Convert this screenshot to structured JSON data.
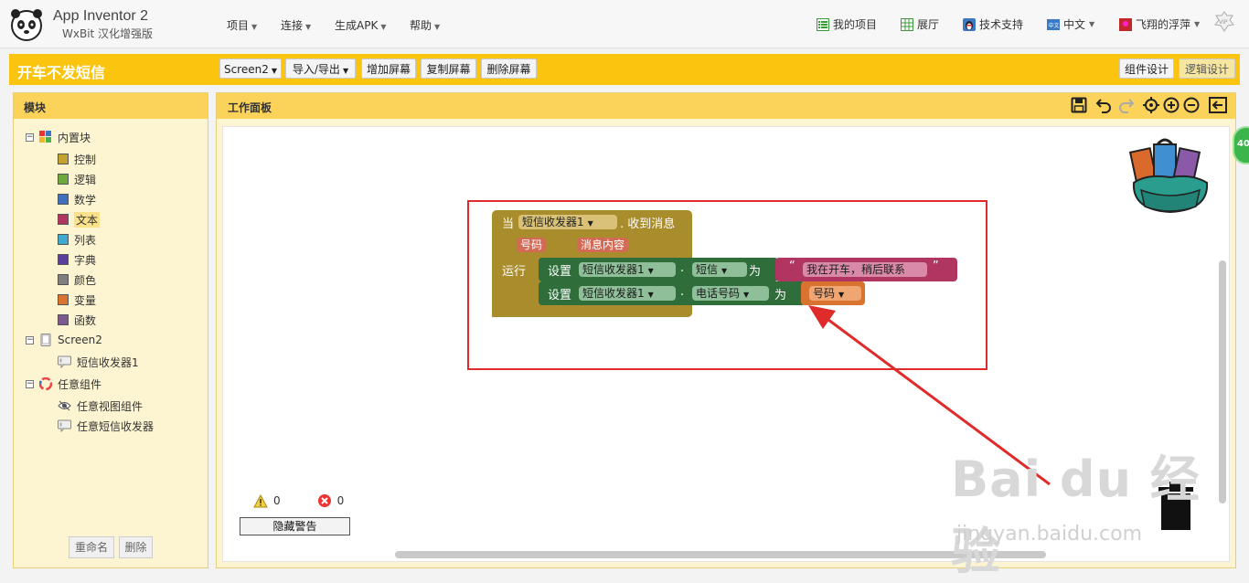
{
  "header": {
    "app_title": "App Inventor 2",
    "app_subtitle": "WxBit 汉化增强版",
    "menus": [
      {
        "label": "项目"
      },
      {
        "label": "连接"
      },
      {
        "label": "生成APK"
      },
      {
        "label": "帮助"
      }
    ],
    "right": {
      "my_projects": "我的项目",
      "gallery": "展厅",
      "support": "技术支持",
      "language": "中文",
      "user": "飞翔的浮萍",
      "vip_badge": "VIP"
    }
  },
  "project_bar": {
    "title": "开车不发短信",
    "screen_select": "Screen2",
    "import_export": "导入/导出",
    "add_screen": "增加屏幕",
    "copy_screen": "复制屏幕",
    "delete_screen": "删除屏幕",
    "designer": "组件设计",
    "blocks": "逻辑设计"
  },
  "blocks_panel": {
    "title": "模块",
    "builtin": "内置块",
    "categories": [
      {
        "label": "控制",
        "color": "#c4a22f"
      },
      {
        "label": "逻辑",
        "color": "#6da93f"
      },
      {
        "label": "数学",
        "color": "#3f6fbd"
      },
      {
        "label": "文本",
        "color": "#b13561"
      },
      {
        "label": "列表",
        "color": "#3fa9cf"
      },
      {
        "label": "字典",
        "color": "#5b3f9c"
      },
      {
        "label": "颜色",
        "color": "#7f7f7f"
      },
      {
        "label": "变量",
        "color": "#d8742f"
      },
      {
        "label": "函数",
        "color": "#7c5a8f"
      }
    ],
    "screen": "Screen2",
    "component": "短信收发器1",
    "any_component": "任意组件",
    "any_items": [
      "任意视图组件",
      "任意短信收发器"
    ],
    "rename": "重命名",
    "delete": "删除"
  },
  "workspace": {
    "title": "工作面板",
    "warnings": "0",
    "errors": "0",
    "hide_warnings": "隐藏警告",
    "status_badge": "40",
    "event": {
      "when": "当",
      "component": "短信收发器1",
      "event_name": ". 收到消息",
      "param1": "号码",
      "param2": "消息内容",
      "do": "运行"
    },
    "set1": {
      "set": "设置",
      "component": "短信收发器1",
      "dot": ".",
      "property": "短信",
      "to": "为",
      "text": "我在开车，稍后联系"
    },
    "set2": {
      "set": "设置",
      "component": "短信收发器1",
      "dot": ".",
      "property": "电话号码",
      "to": "为",
      "var": "号码"
    }
  },
  "watermark": {
    "brand": "Bai  du 经验",
    "url": "jingyan.baidu.com"
  }
}
